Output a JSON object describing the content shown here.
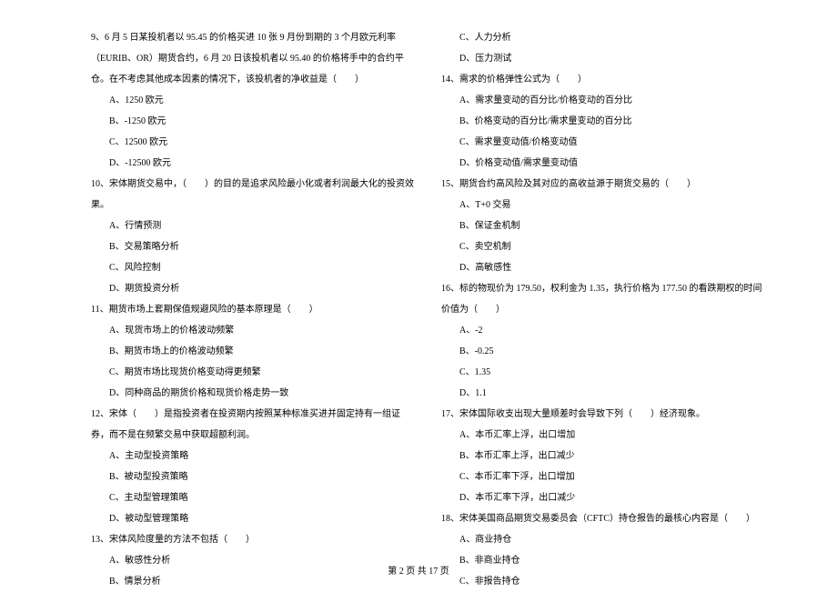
{
  "left": {
    "q9": {
      "text": "9、6 月 5 日某投机者以 95.45 的价格买进 10 张 9 月份到期的 3 个月欧元利率（EURIB、OR）期货合约，6 月 20 日该投机者以 95.40 的价格将手中的合约平仓。在不考虑其他成本因素的情况下，该投机者的净收益是（　　）",
      "A": "A、1250 欧元",
      "B": "B、-1250 欧元",
      "C": "C、12500 欧元",
      "D": "D、-12500 欧元"
    },
    "q10": {
      "text": "10、宋体期货交易中，（　　）的目的是追求风险最小化或者利润最大化的投资效果。",
      "A": "A、行情预测",
      "B": "B、交易策略分析",
      "C": "C、风险控制",
      "D": "D、期货投资分析"
    },
    "q11": {
      "text": "11、期货市场上套期保值规避风险的基本原理是（　　）",
      "A": "A、现货市场上的价格波动频繁",
      "B": "B、期货市场上的价格波动频繁",
      "C": "C、期货市场比现货价格变动得更频繁",
      "D": "D、同种商品的期货价格和现货价格走势一致"
    },
    "q12": {
      "text": "12、宋体（　　）是指投资者在投资期内按照某种标准买进并固定持有一组证券，而不是在频繁交易中获取超额利润。",
      "A": "A、主动型投资策略",
      "B": "B、被动型投资策略",
      "C": "C、主动型管理策略",
      "D": "D、被动型管理策略"
    },
    "q13": {
      "text": "13、宋体风险度量的方法不包括（　　）",
      "A": "A、敏感性分析",
      "B": "B、情景分析"
    }
  },
  "right": {
    "q13c": {
      "C": "C、人力分析",
      "D": "D、压力测试"
    },
    "q14": {
      "text": "14、需求的价格弹性公式为（　　）",
      "A": "A、需求量变动的百分比/价格变动的百分比",
      "B": "B、价格变动的百分比/需求量变动的百分比",
      "C": "C、需求量变动值/价格变动值",
      "D": "D、价格变动值/需求量变动值"
    },
    "q15": {
      "text": "15、期货合约高风险及其对应的高收益源于期货交易的（　　）",
      "A": "A、T+0 交易",
      "B": "B、保证金机制",
      "C": "C、卖空机制",
      "D": "D、高敏感性"
    },
    "q16": {
      "text": "16、标的物现价为 179.50，权利金为 1.35，执行价格为 177.50 的看跌期权的时间价值为（　　）",
      "A": "A、-2",
      "B": "B、-0.25",
      "C": "C、1.35",
      "D": "D、1.1"
    },
    "q17": {
      "text": "17、宋体国际收支出现大量顺差时会导致下列（　　）经济现象。",
      "A": "A、本币汇率上浮，出口增加",
      "B": "B、本币汇率上浮，出口减少",
      "C": "C、本币汇率下浮，出口增加",
      "D": "D、本币汇率下浮，出口减少"
    },
    "q18": {
      "text": "18、宋体美国商品期货交易委员会（CFTC）持仓报告的最核心内容是（　　）",
      "A": "A、商业持仓",
      "B": "B、非商业持仓",
      "C": "C、非报告持仓"
    }
  },
  "footer": "第 2 页 共 17 页"
}
